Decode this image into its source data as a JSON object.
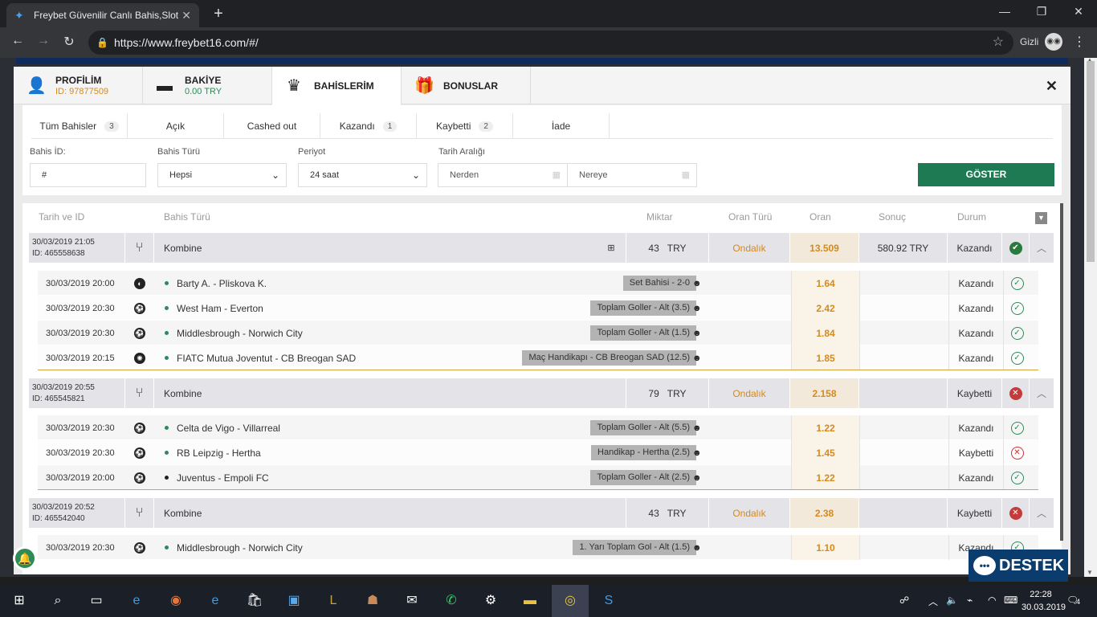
{
  "browser": {
    "tab_title": "Freybet Güvenilir Canlı Bahis,Slot",
    "url": "https://www.freybet16.com/#/",
    "incognito_label": "Gizli",
    "icons": {
      "back": "back-arrow-icon",
      "forward": "forward-arrow-icon",
      "reload": "reload-icon",
      "lock": "lock-icon",
      "star": "star-icon"
    }
  },
  "modal": {
    "tabs": [
      {
        "label": "PROFİLİM",
        "sub": "ID: 97877509",
        "sub_color": "#d48a1e",
        "icon": "user-icon"
      },
      {
        "label": "BAKİYE",
        "sub": "0.00 TRY",
        "sub_color": "#2e8b57",
        "icon": "wallet-icon"
      },
      {
        "label": "BAHİSLERİM",
        "sub": "",
        "icon": "trophy-icon"
      },
      {
        "label": "BONUSLAR",
        "sub": "",
        "icon": "gift-icon"
      }
    ],
    "close_label": "✕"
  },
  "status_tabs": [
    {
      "label": "Tüm Bahisler",
      "count": "3"
    },
    {
      "label": "Açık",
      "count": ""
    },
    {
      "label": "Cashed out",
      "count": ""
    },
    {
      "label": "Kazandı",
      "count": "1"
    },
    {
      "label": "Kaybetti",
      "count": "2"
    },
    {
      "label": "İade",
      "count": ""
    }
  ],
  "filters": {
    "bet_id_label": "Bahis İD:",
    "bet_id_value": "#",
    "bet_type_label": "Bahis Türü",
    "bet_type_value": "Hepsi",
    "period_label": "Periyot",
    "period_value": "24 saat",
    "date_range_label": "Tarih Aralığı",
    "from_placeholder": "Nerden",
    "to_placeholder": "Nereye",
    "submit_label": "GÖSTER"
  },
  "table_headers": {
    "date_id": "Tarih ve ID",
    "bet_type": "Bahis Türü",
    "amount": "Miktar",
    "odds_type": "Oran Türü",
    "odds": "Oran",
    "result": "Sonuç",
    "status": "Durum"
  },
  "bets": [
    {
      "date": "30/03/2019 21:05",
      "id": "ID: 465558638",
      "type": "Kombine",
      "amount": "43",
      "currency": "TRY",
      "odds_type": "Ondalık",
      "odds": "13.509",
      "result": "580.92 TRY",
      "status": "Kazandı",
      "won": true,
      "has_gift": true,
      "selections": [
        {
          "date": "30/03/2019 20:00",
          "sport": "tennis-icon",
          "event": "Barty A. - Pliskova K.",
          "market": "Set Bahisi - 2-0",
          "odds": "1.64",
          "status": "Kazandı",
          "won": true,
          "dot": "green"
        },
        {
          "date": "30/03/2019 20:30",
          "sport": "soccer-icon",
          "event": "West Ham - Everton",
          "market": "Toplam Goller - Alt (3.5)",
          "odds": "2.42",
          "status": "Kazandı",
          "won": true,
          "dot": "green"
        },
        {
          "date": "30/03/2019 20:30",
          "sport": "soccer-icon",
          "event": "Middlesbrough - Norwich City",
          "market": "Toplam Goller - Alt (1.5)",
          "odds": "1.84",
          "status": "Kazandı",
          "won": true,
          "dot": "green"
        },
        {
          "date": "30/03/2019 20:15",
          "sport": "basketball-icon",
          "event": "FIATC Mutua Joventut - CB Breogan SAD",
          "market": "Maç Handikapı - CB Breogan SAD (12.5)",
          "odds": "1.85",
          "status": "Kazandı",
          "won": true,
          "dot": "green"
        }
      ]
    },
    {
      "date": "30/03/2019 20:55",
      "id": "ID: 465545821",
      "type": "Kombine",
      "amount": "79",
      "currency": "TRY",
      "odds_type": "Ondalık",
      "odds": "2.158",
      "result": "",
      "status": "Kaybetti",
      "won": false,
      "has_gift": false,
      "selections": [
        {
          "date": "30/03/2019 20:30",
          "sport": "soccer-icon",
          "event": "Celta de Vigo - Villarreal",
          "market": "Toplam Goller - Alt (5.5)",
          "odds": "1.22",
          "status": "Kazandı",
          "won": true,
          "dot": "green"
        },
        {
          "date": "30/03/2019 20:30",
          "sport": "soccer-icon",
          "event": "RB Leipzig - Hertha",
          "market": "Handikap - Hertha (2.5)",
          "odds": "1.45",
          "status": "Kaybetti",
          "won": false,
          "dot": "green"
        },
        {
          "date": "30/03/2019 20:00",
          "sport": "soccer-icon",
          "event": "Juventus - Empoli FC",
          "market": "Toplam Goller - Alt (2.5)",
          "odds": "1.22",
          "status": "Kazandı",
          "won": true,
          "dot": "black"
        }
      ]
    },
    {
      "date": "30/03/2019 20:52",
      "id": "ID: 465542040",
      "type": "Kombine",
      "amount": "43",
      "currency": "TRY",
      "odds_type": "Ondalık",
      "odds": "2.38",
      "result": "",
      "status": "Kaybetti",
      "won": false,
      "has_gift": false,
      "selections": [
        {
          "date": "30/03/2019 20:30",
          "sport": "soccer-icon",
          "event": "Middlesbrough - Norwich City",
          "market": "1. Yarı Toplam Gol - Alt (1.5)",
          "odds": "1.10",
          "status": "Kazandı",
          "won": true,
          "dot": "green"
        }
      ]
    }
  ],
  "support_label": "DESTEK",
  "taskbar": {
    "time": "22:28",
    "date": "30.03.2019",
    "notif_count": "4"
  },
  "colors": {
    "accent_orange": "#d48a1e",
    "win_green": "#2e8b57",
    "lose_red": "#c53a3a",
    "button_green": "#1e7a52"
  }
}
